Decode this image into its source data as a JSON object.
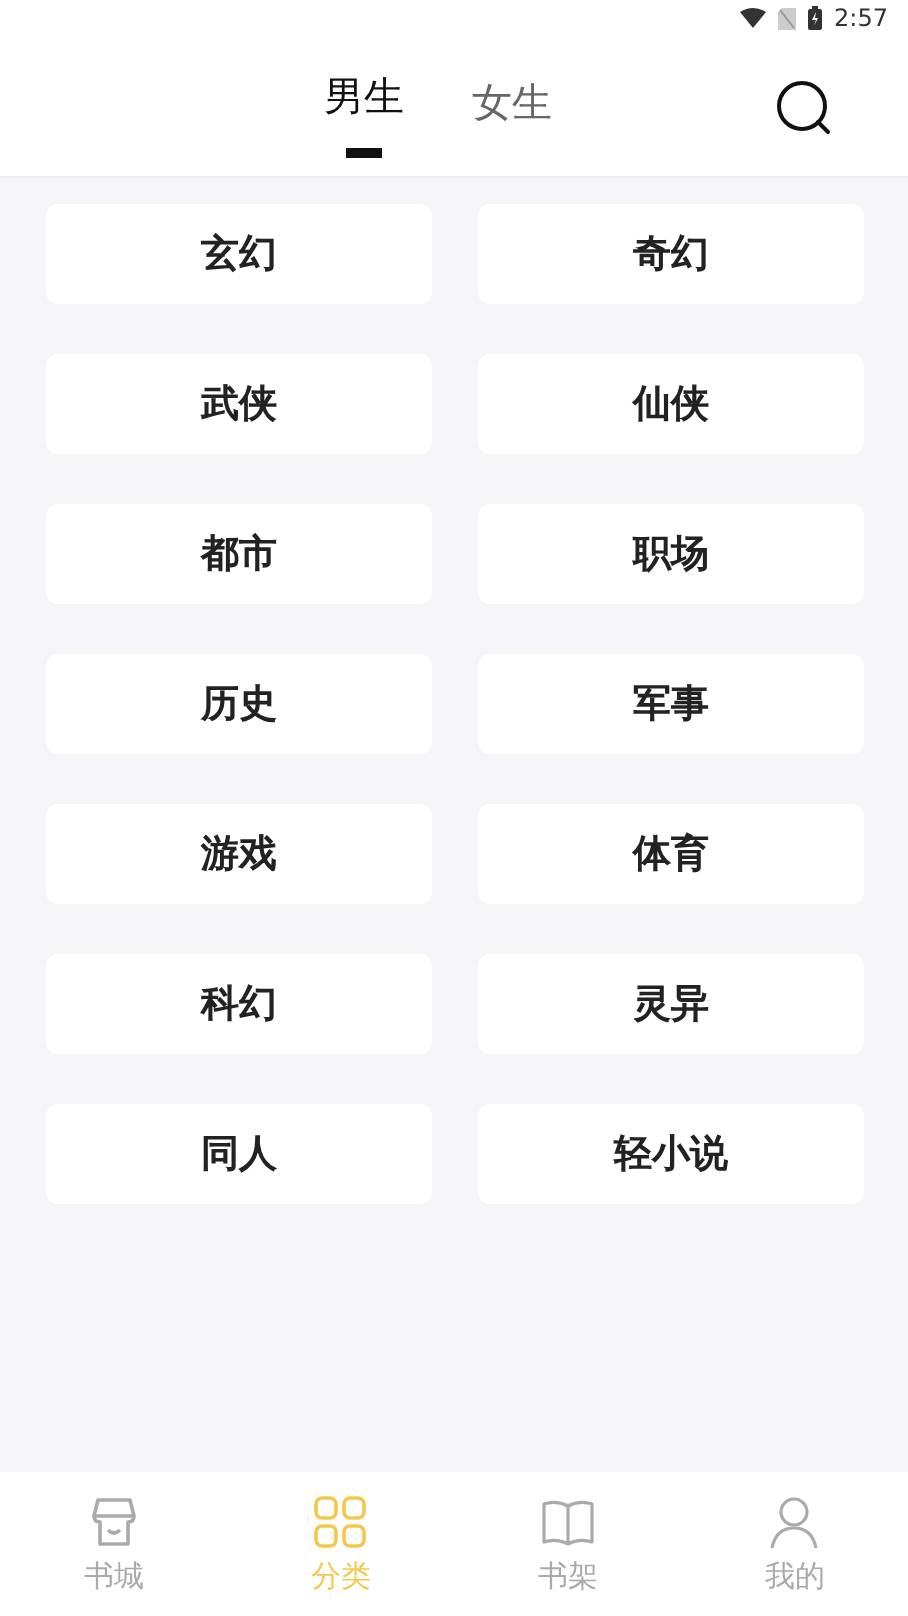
{
  "status_bar": {
    "time": "2:57"
  },
  "tabs": [
    {
      "label": "男生",
      "selected": true
    },
    {
      "label": "女生",
      "selected": false
    }
  ],
  "categories": [
    {
      "label": "玄幻"
    },
    {
      "label": "奇幻"
    },
    {
      "label": "武侠"
    },
    {
      "label": "仙侠"
    },
    {
      "label": "都市"
    },
    {
      "label": "职场"
    },
    {
      "label": "历史"
    },
    {
      "label": "军事"
    },
    {
      "label": "游戏"
    },
    {
      "label": "体育"
    },
    {
      "label": "科幻"
    },
    {
      "label": "灵异"
    },
    {
      "label": "同人"
    },
    {
      "label": "轻小说"
    }
  ],
  "bottom_nav": [
    {
      "kind": "store",
      "label": "书城",
      "selected": false
    },
    {
      "kind": "grid",
      "label": "分类",
      "selected": true
    },
    {
      "kind": "book",
      "label": "书架",
      "selected": false
    },
    {
      "kind": "person",
      "label": "我的",
      "selected": false
    }
  ]
}
